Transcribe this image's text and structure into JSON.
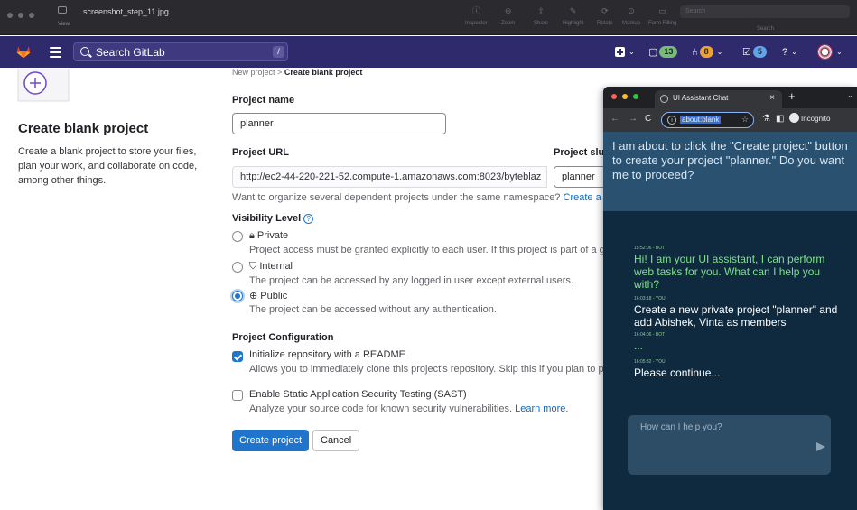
{
  "mac_bar": {
    "title": "screenshot_step_11.jpg",
    "view_label": "View",
    "tools": [
      {
        "icon": "ⓘ",
        "label": "Inspector"
      },
      {
        "icon": "⊕",
        "label": "Zoom"
      },
      {
        "icon": "⇧",
        "label": "Share"
      },
      {
        "icon": "✎",
        "label": "Highlight"
      },
      {
        "icon": "⟳",
        "label": "Rotate"
      },
      {
        "icon": "⊙",
        "label": "Markup"
      },
      {
        "icon": "▭",
        "label": "Form Filling"
      }
    ],
    "search_placeholder": "Search",
    "search_label": "Search"
  },
  "gitlab_nav": {
    "search_placeholder": "Search GitLab",
    "search_shortcut": "/",
    "issues_count": "13",
    "mr_count": "8",
    "todo_count": "5",
    "brand_color": "#2f2a6b"
  },
  "left_panel": {
    "title": "Create blank project",
    "description": "Create a blank project to store your files, plan your work, and collaborate on code, among other things."
  },
  "breadcrumb": {
    "parent": "New project",
    "separator": ">",
    "current": "Create blank project"
  },
  "form": {
    "project_name_label": "Project name",
    "project_name_value": "planner",
    "project_url_label": "Project URL",
    "project_url_prefix": "http://ec2-44-220-221-52.compute-1.amazonaws.com:8023/byteblaz",
    "project_slug_label": "Project slug",
    "project_slug_value": "planner",
    "namespace_hint": "Want to organize several dependent projects under the same namespace?",
    "namespace_link": "Create a group",
    "visibility_label": "Visibility Level",
    "visibility_options": [
      {
        "label": "Private",
        "description": "Project access must be granted explicitly to each user. If this project is part of a group, access will be granted to members of the group.",
        "selected": false
      },
      {
        "label": "Internal",
        "description": "The project can be accessed by any logged in user except external users.",
        "selected": false
      },
      {
        "label": "Public",
        "description": "The project can be accessed without any authentication.",
        "selected": true
      }
    ],
    "config_label": "Project Configuration",
    "readme_label": "Initialize repository with a README",
    "readme_checked": true,
    "readme_help": "Allows you to immediately clone this project's repository. Skip this if you plan to push up an existing repository.",
    "sast_label": "Enable Static Application Security Testing (SAST)",
    "sast_checked": false,
    "sast_help": "Analyze your source code for known security vulnerabilities.",
    "sast_link": "Learn more.",
    "create_button": "Create project",
    "cancel_button": "Cancel"
  },
  "chat": {
    "tab_title": "UI Assistant Chat",
    "address": "about:blank",
    "incognito_label": "Incognito",
    "prompt_text": "I am about to click the \"Create project\" button to create your project \"planner.\" Do you want me to proceed?",
    "messages": [
      {
        "meta": "15:52:06 - BOT",
        "text": "Hi! I am your UI assistant, I can perform web tasks for you. What can I help you with?",
        "role": "bot"
      },
      {
        "meta": "16:03:18 - YOU",
        "text": "Create a new private project \"planner\" and add Abishek, Vinta as members",
        "role": "you"
      },
      {
        "meta": "16:04:06 - BOT",
        "text": "...",
        "role": "bot"
      },
      {
        "meta": "16:05:32 - YOU",
        "text": "Please continue...",
        "role": "you"
      }
    ],
    "input_placeholder": "How can I help you?"
  }
}
